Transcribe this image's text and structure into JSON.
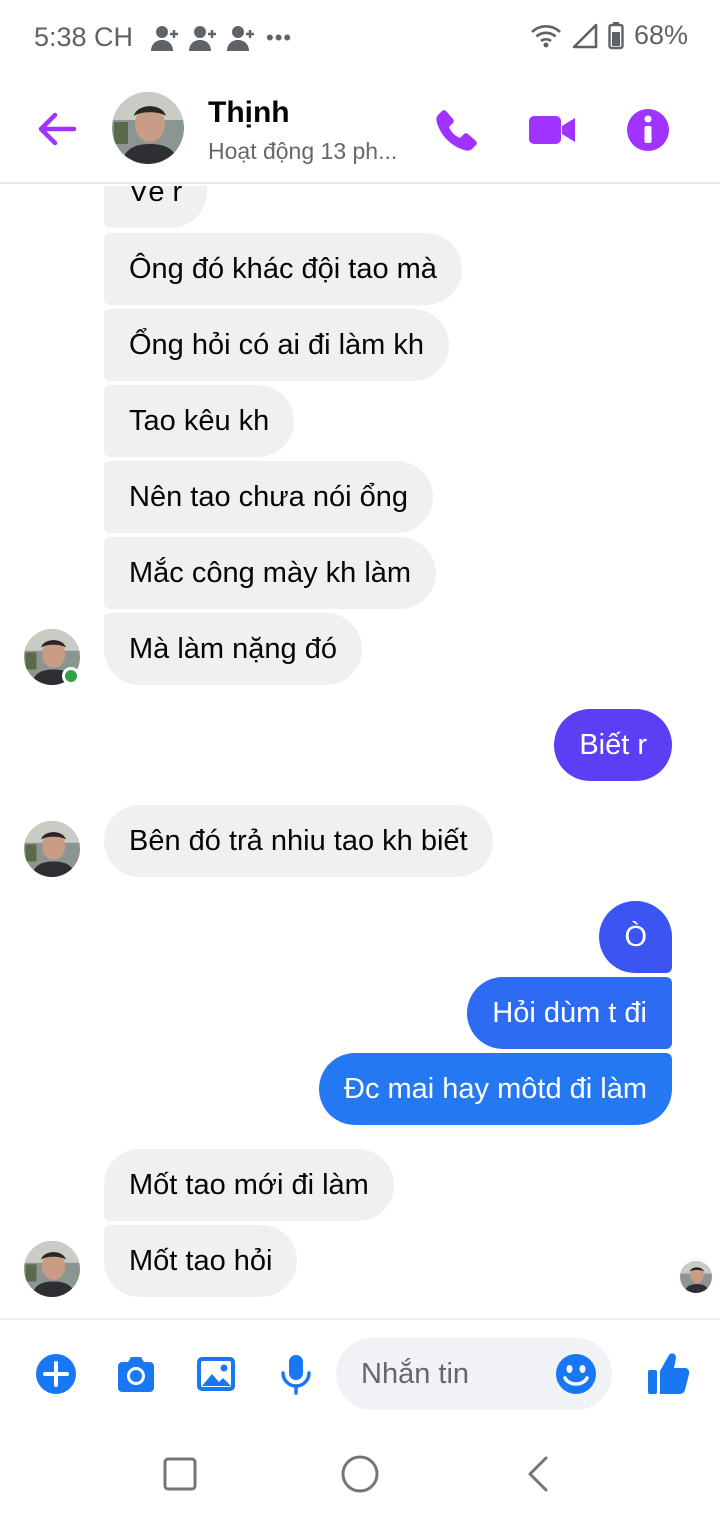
{
  "status_bar": {
    "time": "5:38 CH",
    "more": "•••",
    "battery_pct": "68%"
  },
  "header": {
    "name": "Thịnh",
    "status": "Hoạt động 13 ph..."
  },
  "messages": [
    {
      "text": "Về r",
      "side": "in"
    },
    {
      "text": "Ông đó khác đội tao mà",
      "side": "in"
    },
    {
      "text": "Ổng hỏi có ai đi làm kh",
      "side": "in"
    },
    {
      "text": "Tao kêu kh",
      "side": "in"
    },
    {
      "text": "Nên tao chưa nói ổng",
      "side": "in"
    },
    {
      "text": "Mắc công mày kh làm",
      "side": "in"
    },
    {
      "text": "Mà làm nặng đó",
      "side": "in"
    },
    {
      "text": "Biết r",
      "side": "out"
    },
    {
      "text": "Bên đó trả nhiu tao kh biết",
      "side": "in"
    },
    {
      "text": "Ò",
      "side": "out"
    },
    {
      "text": "Hỏi dùm t đi",
      "side": "out"
    },
    {
      "text": "Đc mai hay môtd đi làm",
      "side": "out"
    },
    {
      "text": "Mốt tao mới đi làm",
      "side": "in"
    },
    {
      "text": "Mốt tao hỏi",
      "side": "in"
    }
  ],
  "composer": {
    "placeholder": "Nhắn tin"
  },
  "colors": {
    "accent": "#a033ff",
    "messenger_blue": "#1877f2",
    "bubble_purple": "#5b3ff5",
    "bubble_blue_1": "#3b55f2",
    "bubble_blue_2": "#2d6cf2",
    "bubble_blue_3": "#2479f2",
    "incoming_bg": "#f0f0f0"
  },
  "icons": {
    "back": "arrow-left-icon",
    "call": "phone-icon",
    "video": "video-camera-icon",
    "info": "info-icon",
    "add": "plus-circle-icon",
    "camera": "camera-icon",
    "gallery": "image-icon",
    "mic": "microphone-icon",
    "emoji": "emoji-icon",
    "like": "thumbs-up-icon"
  }
}
